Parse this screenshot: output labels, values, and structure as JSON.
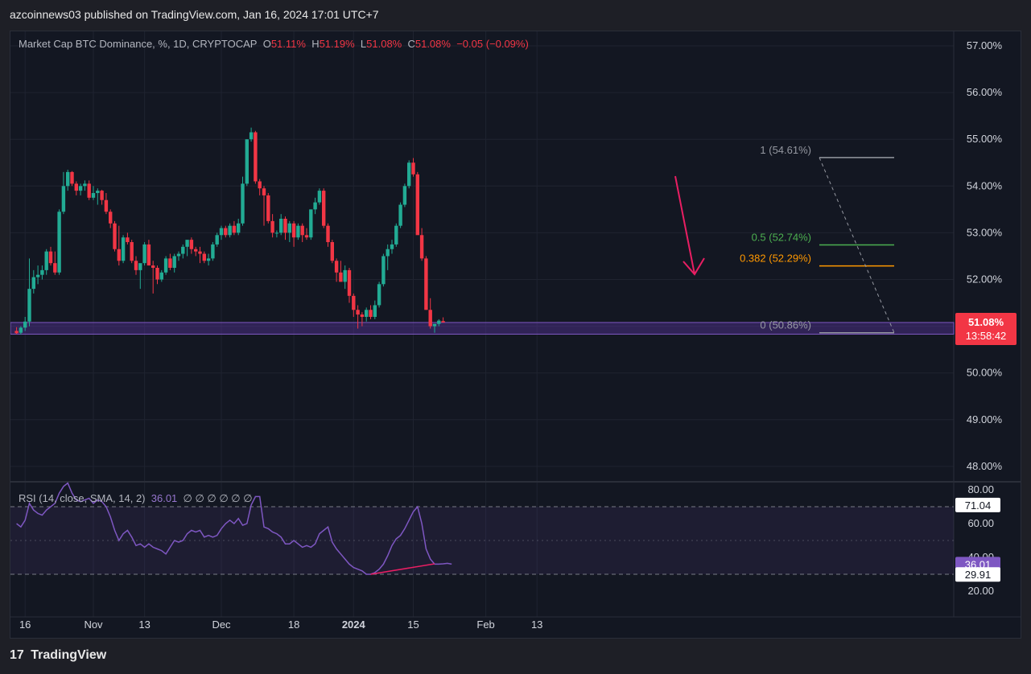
{
  "header": {
    "publisher": "azcoinnews03 published on TradingView.com, Jan 16, 2024 17:01 UTC+7"
  },
  "legend": {
    "symbol": "Market Cap BTC Dominance, %, 1D, CRYPTOCAP",
    "o_label": "O",
    "o_value": "51.11%",
    "h_label": "H",
    "h_value": "51.19%",
    "l_label": "L",
    "l_value": "51.08%",
    "c_label": "C",
    "c_value": "51.08%",
    "change": "−0.05 (−0.09%)"
  },
  "rsi_legend": {
    "label": "RSI (14, close, SMA, 14, 2)",
    "value": "36.01",
    "extra": "∅ ∅ ∅ ∅ ∅ ∅"
  },
  "footer": {
    "logo": "17",
    "brand": "TradingView"
  },
  "colors": {
    "up": "#22ab94",
    "down": "#f23645",
    "rsi": "#7e57c2",
    "fib_half": "#4caf50",
    "fib_382": "#ff9800",
    "fib_line": "#9598a1",
    "arrow": "#e91e63",
    "zone": "#673ab7"
  },
  "chart_data": {
    "type": "candlestick",
    "title": "Market Cap BTC Dominance, %, 1D, CRYPTOCAP",
    "price_axis_labels": [
      "57.00%",
      "56.00%",
      "55.00%",
      "54.00%",
      "53.00%",
      "52.00%",
      "51.00%",
      "50.00%",
      "49.00%",
      "48.00%"
    ],
    "ylim": [
      47.7,
      57.3
    ],
    "time_axis_labels": [
      {
        "text": "16",
        "date": "2023-10-16",
        "bold": false
      },
      {
        "text": "Nov",
        "date": "2023-11-01",
        "bold": false
      },
      {
        "text": "13",
        "date": "2023-11-13",
        "bold": false
      },
      {
        "text": "Dec",
        "date": "2023-12-01",
        "bold": false
      },
      {
        "text": "18",
        "date": "2023-12-18",
        "bold": false
      },
      {
        "text": "2024",
        "date": "2024-01-01",
        "bold": true
      },
      {
        "text": "15",
        "date": "2024-01-15",
        "bold": false
      },
      {
        "text": "Feb",
        "date": "2024-02-01",
        "bold": false
      },
      {
        "text": "13",
        "date": "2024-02-13",
        "bold": false
      }
    ],
    "last_price": {
      "label": "51.08%",
      "countdown": "13:58:42",
      "value": 51.08
    },
    "fib": [
      {
        "label": "1 (54.61%)",
        "value": 54.61,
        "color": "#9598a1"
      },
      {
        "label": "0.5 (52.74%)",
        "value": 52.74,
        "color": "#4caf50"
      },
      {
        "label": "0.382 (52.29%)",
        "value": 52.29,
        "color": "#ff9800"
      },
      {
        "label": "0 (50.86%)",
        "value": 50.86,
        "color": "#9598a1"
      }
    ],
    "zone": {
      "from": 50.83,
      "to": 51.08
    },
    "candles": [
      {
        "o": 50.9,
        "h": 50.98,
        "l": 50.83,
        "c": 50.85
      },
      {
        "o": 50.86,
        "h": 51.0,
        "l": 50.82,
        "c": 50.97
      },
      {
        "o": 50.97,
        "h": 51.2,
        "l": 50.9,
        "c": 51.1
      },
      {
        "o": 51.1,
        "h": 52.45,
        "l": 51.0,
        "c": 51.8
      },
      {
        "o": 51.8,
        "h": 52.2,
        "l": 51.7,
        "c": 52.05
      },
      {
        "o": 52.05,
        "h": 52.3,
        "l": 51.9,
        "c": 52.1
      },
      {
        "o": 52.1,
        "h": 52.3,
        "l": 52.0,
        "c": 52.2
      },
      {
        "o": 52.2,
        "h": 52.65,
        "l": 52.1,
        "c": 52.6
      },
      {
        "o": 52.6,
        "h": 52.7,
        "l": 52.3,
        "c": 52.35
      },
      {
        "o": 52.35,
        "h": 52.6,
        "l": 52.1,
        "c": 52.15
      },
      {
        "o": 52.15,
        "h": 53.5,
        "l": 52.1,
        "c": 53.45
      },
      {
        "o": 53.45,
        "h": 54.3,
        "l": 53.4,
        "c": 54.0
      },
      {
        "o": 54.0,
        "h": 54.35,
        "l": 53.9,
        "c": 54.3
      },
      {
        "o": 54.3,
        "h": 54.32,
        "l": 54.0,
        "c": 54.05
      },
      {
        "o": 54.05,
        "h": 54.1,
        "l": 53.8,
        "c": 53.9
      },
      {
        "o": 53.9,
        "h": 54.05,
        "l": 53.8,
        "c": 54.0
      },
      {
        "o": 54.0,
        "h": 54.12,
        "l": 53.9,
        "c": 54.05
      },
      {
        "o": 54.05,
        "h": 54.12,
        "l": 53.7,
        "c": 53.75
      },
      {
        "o": 53.75,
        "h": 54.0,
        "l": 53.7,
        "c": 53.85
      },
      {
        "o": 53.85,
        "h": 53.95,
        "l": 53.6,
        "c": 53.9
      },
      {
        "o": 53.9,
        "h": 53.92,
        "l": 53.6,
        "c": 53.7
      },
      {
        "o": 53.7,
        "h": 53.85,
        "l": 53.4,
        "c": 53.45
      },
      {
        "o": 53.45,
        "h": 53.5,
        "l": 53.1,
        "c": 53.2
      },
      {
        "o": 53.2,
        "h": 53.25,
        "l": 52.6,
        "c": 52.65
      },
      {
        "o": 52.65,
        "h": 53.15,
        "l": 52.3,
        "c": 52.4
      },
      {
        "o": 52.4,
        "h": 52.95,
        "l": 52.35,
        "c": 52.9
      },
      {
        "o": 52.9,
        "h": 53.0,
        "l": 52.75,
        "c": 52.8
      },
      {
        "o": 52.8,
        "h": 52.85,
        "l": 52.35,
        "c": 52.4
      },
      {
        "o": 52.4,
        "h": 52.5,
        "l": 52.1,
        "c": 52.2
      },
      {
        "o": 52.2,
        "h": 52.3,
        "l": 51.8,
        "c": 52.35
      },
      {
        "o": 52.35,
        "h": 52.8,
        "l": 52.3,
        "c": 52.75
      },
      {
        "o": 52.75,
        "h": 52.85,
        "l": 52.3,
        "c": 52.3
      },
      {
        "o": 52.3,
        "h": 52.4,
        "l": 51.7,
        "c": 52.25
      },
      {
        "o": 52.25,
        "h": 52.3,
        "l": 51.9,
        "c": 52.0
      },
      {
        "o": 52.0,
        "h": 52.2,
        "l": 51.95,
        "c": 52.15
      },
      {
        "o": 52.15,
        "h": 52.5,
        "l": 52.1,
        "c": 52.45
      },
      {
        "o": 52.45,
        "h": 52.55,
        "l": 52.2,
        "c": 52.25
      },
      {
        "o": 52.25,
        "h": 52.55,
        "l": 52.15,
        "c": 52.5
      },
      {
        "o": 52.5,
        "h": 52.6,
        "l": 52.4,
        "c": 52.55
      },
      {
        "o": 52.55,
        "h": 52.75,
        "l": 52.45,
        "c": 52.7
      },
      {
        "o": 52.7,
        "h": 52.8,
        "l": 52.5,
        "c": 52.85
      },
      {
        "o": 52.85,
        "h": 52.9,
        "l": 52.55,
        "c": 52.65
      },
      {
        "o": 52.65,
        "h": 52.7,
        "l": 52.5,
        "c": 52.6
      },
      {
        "o": 52.6,
        "h": 52.7,
        "l": 52.35,
        "c": 52.55
      },
      {
        "o": 52.55,
        "h": 52.6,
        "l": 52.35,
        "c": 52.4
      },
      {
        "o": 52.4,
        "h": 52.55,
        "l": 52.3,
        "c": 52.45
      },
      {
        "o": 52.45,
        "h": 52.8,
        "l": 52.4,
        "c": 52.75
      },
      {
        "o": 52.75,
        "h": 53.0,
        "l": 52.7,
        "c": 52.95
      },
      {
        "o": 52.95,
        "h": 53.15,
        "l": 52.85,
        "c": 53.1
      },
      {
        "o": 53.1,
        "h": 53.15,
        "l": 52.9,
        "c": 52.95
      },
      {
        "o": 52.95,
        "h": 53.2,
        "l": 52.9,
        "c": 53.15
      },
      {
        "o": 53.15,
        "h": 53.25,
        "l": 52.95,
        "c": 53.0
      },
      {
        "o": 53.0,
        "h": 53.3,
        "l": 52.95,
        "c": 53.2
      },
      {
        "o": 53.2,
        "h": 54.2,
        "l": 53.15,
        "c": 54.05
      },
      {
        "o": 54.05,
        "h": 55.0,
        "l": 54.0,
        "c": 55.0
      },
      {
        "o": 55.0,
        "h": 55.25,
        "l": 54.95,
        "c": 55.15
      },
      {
        "o": 55.15,
        "h": 55.18,
        "l": 54.05,
        "c": 54.1
      },
      {
        "o": 54.1,
        "h": 54.15,
        "l": 53.8,
        "c": 53.95
      },
      {
        "o": 53.95,
        "h": 54.0,
        "l": 53.15,
        "c": 53.8
      },
      {
        "o": 53.8,
        "h": 53.85,
        "l": 53.2,
        "c": 53.25
      },
      {
        "o": 53.25,
        "h": 53.4,
        "l": 52.9,
        "c": 53.0
      },
      {
        "o": 53.0,
        "h": 53.05,
        "l": 52.9,
        "c": 53.0
      },
      {
        "o": 53.0,
        "h": 53.4,
        "l": 52.95,
        "c": 53.3
      },
      {
        "o": 53.3,
        "h": 53.35,
        "l": 52.85,
        "c": 53.0
      },
      {
        "o": 53.0,
        "h": 53.25,
        "l": 52.8,
        "c": 53.2
      },
      {
        "o": 53.2,
        "h": 53.25,
        "l": 52.7,
        "c": 52.9
      },
      {
        "o": 52.9,
        "h": 53.2,
        "l": 52.85,
        "c": 53.15
      },
      {
        "o": 53.15,
        "h": 53.2,
        "l": 52.8,
        "c": 52.95
      },
      {
        "o": 52.95,
        "h": 53.1,
        "l": 52.85,
        "c": 52.9
      },
      {
        "o": 52.9,
        "h": 53.5,
        "l": 52.85,
        "c": 53.5
      },
      {
        "o": 53.5,
        "h": 53.75,
        "l": 53.4,
        "c": 53.65
      },
      {
        "o": 53.65,
        "h": 53.95,
        "l": 53.6,
        "c": 53.9
      },
      {
        "o": 53.9,
        "h": 53.95,
        "l": 53.1,
        "c": 53.15
      },
      {
        "o": 53.15,
        "h": 53.2,
        "l": 52.7,
        "c": 52.8
      },
      {
        "o": 52.8,
        "h": 52.85,
        "l": 52.35,
        "c": 52.4
      },
      {
        "o": 52.4,
        "h": 52.45,
        "l": 51.95,
        "c": 52.15
      },
      {
        "o": 52.15,
        "h": 52.4,
        "l": 51.95,
        "c": 51.95
      },
      {
        "o": 51.95,
        "h": 52.3,
        "l": 51.8,
        "c": 52.2
      },
      {
        "o": 52.2,
        "h": 52.25,
        "l": 51.5,
        "c": 51.65
      },
      {
        "o": 51.65,
        "h": 51.7,
        "l": 51.2,
        "c": 51.35
      },
      {
        "o": 51.35,
        "h": 51.45,
        "l": 50.95,
        "c": 51.25
      },
      {
        "o": 51.25,
        "h": 51.3,
        "l": 51.0,
        "c": 51.2
      },
      {
        "o": 51.2,
        "h": 51.4,
        "l": 51.1,
        "c": 51.35
      },
      {
        "o": 51.35,
        "h": 51.45,
        "l": 51.15,
        "c": 51.2
      },
      {
        "o": 51.2,
        "h": 51.55,
        "l": 51.15,
        "c": 51.45
      },
      {
        "o": 51.45,
        "h": 51.95,
        "l": 51.4,
        "c": 51.9
      },
      {
        "o": 51.9,
        "h": 52.55,
        "l": 51.85,
        "c": 52.5
      },
      {
        "o": 52.5,
        "h": 52.75,
        "l": 52.2,
        "c": 52.65
      },
      {
        "o": 52.65,
        "h": 52.85,
        "l": 52.55,
        "c": 52.75
      },
      {
        "o": 52.75,
        "h": 53.2,
        "l": 52.7,
        "c": 53.15
      },
      {
        "o": 53.15,
        "h": 53.65,
        "l": 53.1,
        "c": 53.6
      },
      {
        "o": 53.6,
        "h": 54.05,
        "l": 53.55,
        "c": 54.0
      },
      {
        "o": 54.0,
        "h": 54.55,
        "l": 53.95,
        "c": 54.5
      },
      {
        "o": 54.5,
        "h": 54.6,
        "l": 54.2,
        "c": 54.25
      },
      {
        "o": 54.25,
        "h": 54.3,
        "l": 53.0,
        "c": 52.95
      },
      {
        "o": 52.95,
        "h": 53.1,
        "l": 52.4,
        "c": 52.45
      },
      {
        "o": 52.45,
        "h": 52.5,
        "l": 51.35,
        "c": 51.35
      },
      {
        "o": 51.35,
        "h": 51.6,
        "l": 50.95,
        "c": 51.0
      },
      {
        "o": 51.0,
        "h": 51.05,
        "l": 50.86,
        "c": 51.05
      },
      {
        "o": 51.05,
        "h": 51.15,
        "l": 51.0,
        "c": 51.12
      },
      {
        "o": 51.11,
        "h": 51.19,
        "l": 51.08,
        "c": 51.08
      }
    ],
    "rsi": {
      "label": "RSI (14, close, SMA, 14, 2)",
      "axis_labels": [
        "80.00",
        "60.00",
        "40.00",
        "20.00"
      ],
      "ylim": [
        14,
        82
      ],
      "bands": [
        70,
        30
      ],
      "mid": 50,
      "marker_values": [
        "71.04",
        "36.01",
        "29.91"
      ],
      "values": [
        60,
        58,
        62,
        72,
        68,
        66,
        65,
        68,
        70,
        72,
        78,
        82,
        84,
        78,
        74,
        73,
        74,
        75,
        72,
        74,
        73,
        70,
        64,
        56,
        50,
        54,
        56,
        52,
        47,
        48,
        46,
        48,
        46,
        45,
        44,
        42,
        46,
        50,
        49,
        50,
        54,
        56,
        55,
        56,
        52,
        53,
        52,
        53,
        57,
        60,
        62,
        60,
        63,
        59,
        60,
        71,
        76,
        76,
        58,
        57,
        55,
        54,
        52,
        48,
        48,
        50,
        48,
        46,
        47,
        46,
        48,
        54,
        56,
        58,
        49,
        45,
        42,
        39,
        36,
        34,
        33,
        32,
        30,
        30,
        31,
        33,
        36,
        41,
        47,
        51,
        53,
        57,
        62,
        67,
        70,
        60,
        45,
        39,
        36,
        36,
        36.2,
        36.5,
        36.01
      ],
      "divergence_line": {
        "from_value": 30,
        "to_value": 36.2
      }
    }
  }
}
